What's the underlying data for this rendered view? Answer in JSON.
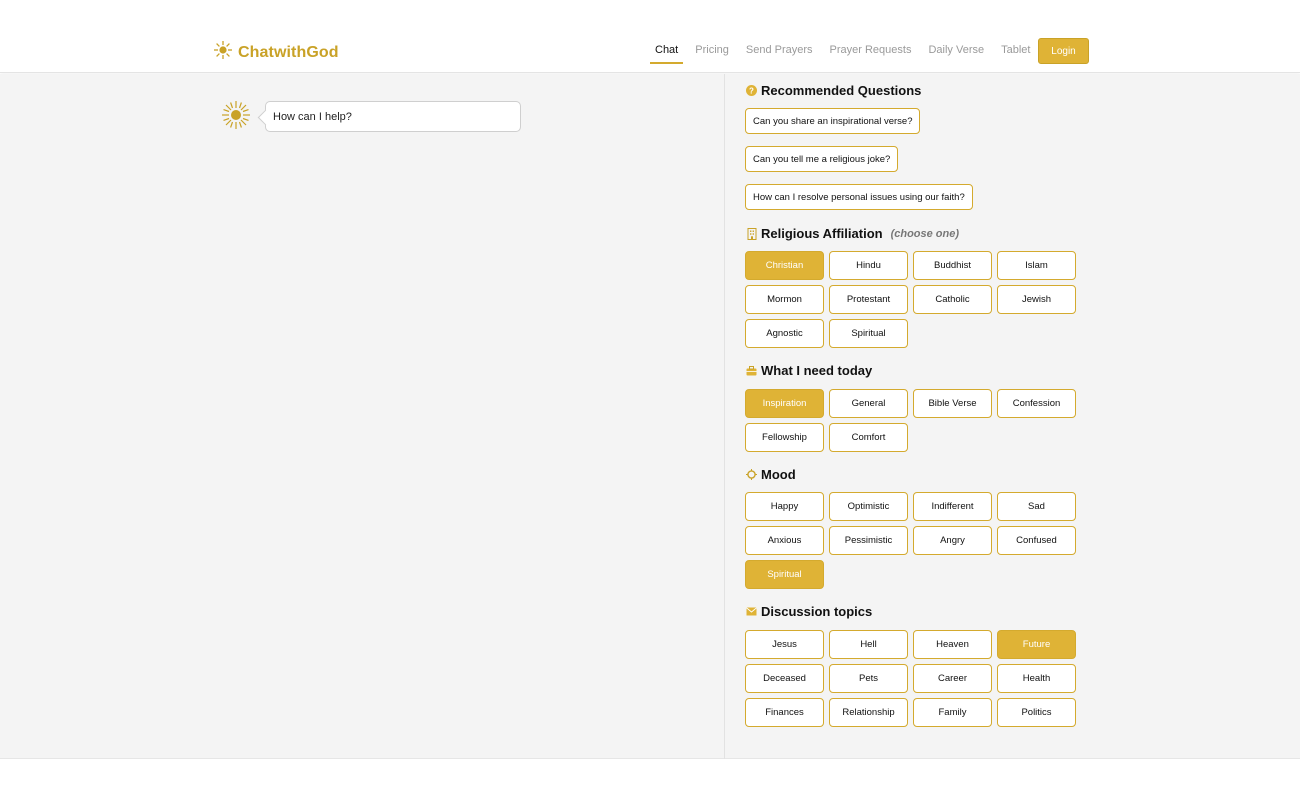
{
  "brand": {
    "name": "ChatwithGod",
    "color": "#c9a227"
  },
  "nav": {
    "items": [
      "Chat",
      "Pricing",
      "Send Prayers",
      "Prayer Requests",
      "Daily Verse",
      "Tablet"
    ],
    "active": "Chat",
    "login_label": "Login"
  },
  "chat": {
    "greeting": "How can I help?",
    "avatar_icon": "sun-icon"
  },
  "recommended": {
    "title": "Recommended Questions",
    "icon": "question-circle-icon",
    "questions": [
      "Can you share an inspirational verse?",
      "Can you tell me a religious joke?",
      "How can I resolve personal issues using our faith?"
    ]
  },
  "affiliation": {
    "title": "Religious Affiliation",
    "hint": "(choose one)",
    "icon": "building-icon",
    "options": [
      "Christian",
      "Hindu",
      "Buddhist",
      "Islam",
      "Mormon",
      "Protestant",
      "Catholic",
      "Jewish",
      "Agnostic",
      "Spiritual"
    ],
    "selected": [
      "Christian"
    ]
  },
  "need": {
    "title": "What I need today",
    "icon": "briefcase-icon",
    "options": [
      "Inspiration",
      "General",
      "Bible Verse",
      "Confession",
      "Fellowship",
      "Comfort"
    ],
    "selected": [
      "Inspiration"
    ]
  },
  "mood": {
    "title": "Mood",
    "icon": "sun-outline-icon",
    "options": [
      "Happy",
      "Optimistic",
      "Indifferent",
      "Sad",
      "Anxious",
      "Pessimistic",
      "Angry",
      "Confused",
      "Spiritual"
    ],
    "selected": [
      "Spiritual"
    ]
  },
  "topics": {
    "title": "Discussion topics",
    "icon": "envelope-icon",
    "options": [
      "Jesus",
      "Hell",
      "Heaven",
      "Future",
      "Deceased",
      "Pets",
      "Career",
      "Health",
      "Finances",
      "Relationship",
      "Family",
      "Politics"
    ],
    "selected": [
      "Future"
    ]
  },
  "colors": {
    "accent": "#dfb336",
    "accent_border": "#d4aa2e",
    "panel_bg": "#f4f4f4"
  }
}
